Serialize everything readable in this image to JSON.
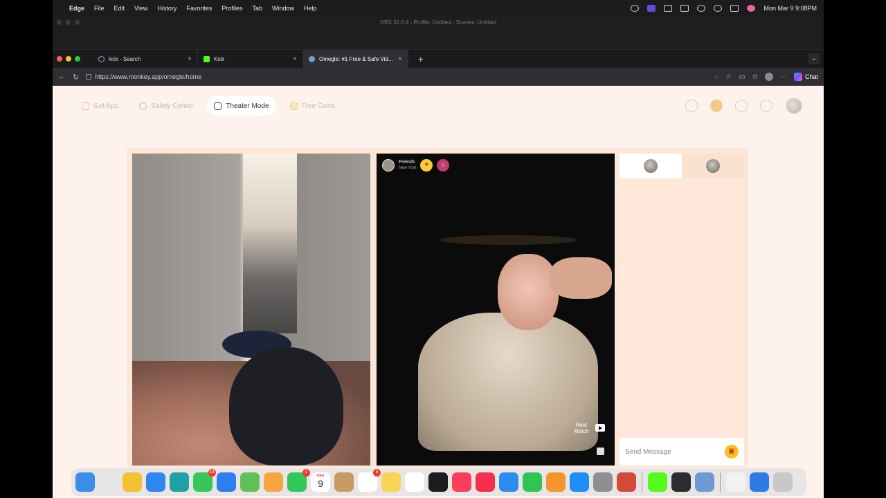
{
  "menubar": {
    "apple": "",
    "app_name": "Edge",
    "menus": [
      "File",
      "Edit",
      "View",
      "History",
      "Favorites",
      "Profiles",
      "Tab",
      "Window",
      "Help"
    ],
    "clock": "Mon Mar 9  9:08PM"
  },
  "obs": {
    "title": "OBS 32.0.4 - Profile: Untitled - Scenes: Untitled"
  },
  "browser": {
    "tabs": [
      {
        "label": "kick - Search",
        "active": false
      },
      {
        "label": "Kick",
        "active": false
      },
      {
        "label": "Omegle: #1 Free & Safe Vid...",
        "active": true
      }
    ],
    "new_tab": "+",
    "url": "https://www.monkey.app/omegle/home",
    "chat_label": "Chat"
  },
  "site": {
    "nav": [
      "Get App",
      "Safety Center",
      "Theater Mode",
      "Free Coins"
    ],
    "active_nav": "Theater Mode"
  },
  "match": {
    "friend_label": "Friends",
    "location": "New York",
    "heart": "♥",
    "next_match": "Next Match"
  },
  "chat": {
    "placeholder": "Send Message"
  },
  "dock": {
    "apps": [
      {
        "name": "finder-icon",
        "color": "#3a8ee6"
      },
      {
        "name": "launchpad-icon",
        "color": "#e7e7ea"
      },
      {
        "name": "chrome-icon",
        "color": "#f2c230"
      },
      {
        "name": "safari-icon",
        "color": "#2f86f0"
      },
      {
        "name": "edge-icon",
        "color": "#1fa1a8"
      },
      {
        "name": "messages-icon",
        "color": "#35c759",
        "badge": "14"
      },
      {
        "name": "mail-icon",
        "color": "#2f7ef0"
      },
      {
        "name": "maps-icon",
        "color": "#61c05a"
      },
      {
        "name": "photos-icon",
        "color": "#f7a541"
      },
      {
        "name": "facetime-icon",
        "color": "#33c75a",
        "badge": "1"
      },
      {
        "name": "calendar-icon",
        "color": "#ffffff",
        "month": "MAR",
        "day": "9"
      },
      {
        "name": "notes-brown-icon",
        "color": "#c79a62"
      },
      {
        "name": "reminders-icon",
        "color": "#ffffff",
        "badge": "5"
      },
      {
        "name": "notes-icon",
        "color": "#f7d456"
      },
      {
        "name": "freeform-icon",
        "color": "#ffffff"
      },
      {
        "name": "appletv-icon",
        "color": "#1c1c1e"
      },
      {
        "name": "music-icon",
        "color": "#f93d5a"
      },
      {
        "name": "news-icon",
        "color": "#f5304f"
      },
      {
        "name": "keynote-icon",
        "color": "#2b8df0"
      },
      {
        "name": "numbers-icon",
        "color": "#30c455"
      },
      {
        "name": "pages-icon",
        "color": "#f5962d"
      },
      {
        "name": "appstore-icon",
        "color": "#1c8ef5"
      },
      {
        "name": "settings-icon",
        "color": "#8e8e93"
      },
      {
        "name": "iphone-mirroring-icon",
        "color": "#d44a3a"
      },
      {
        "name": "sep"
      },
      {
        "name": "kick-icon",
        "color": "#53fc18"
      },
      {
        "name": "obs-icon",
        "color": "#2b2b30"
      },
      {
        "name": "preview-icon",
        "color": "#6e9ad6"
      },
      {
        "name": "sep"
      },
      {
        "name": "document-icon",
        "color": "#f2f2f2"
      },
      {
        "name": "globe-icon",
        "color": "#2d7be6"
      },
      {
        "name": "trash-icon",
        "color": "#c7c7cc"
      }
    ]
  }
}
